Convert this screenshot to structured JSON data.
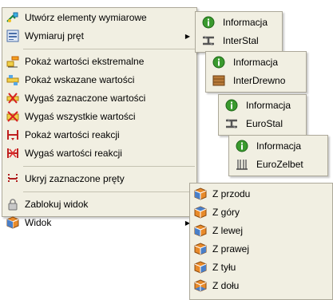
{
  "main_menu": {
    "items": [
      {
        "label": "Utwórz elementy wymiarowe",
        "icon": "create-dimension-elements-icon"
      },
      {
        "label": "Wymiaruj pręt",
        "icon": "dimension-bar-icon",
        "has_submenu": true
      },
      {
        "label": "Pokaż wartości ekstremalne",
        "icon": "show-extreme-values-icon"
      },
      {
        "label": "Pokaż wskazane wartości",
        "icon": "show-selected-values-icon"
      },
      {
        "label": "Wygaś zaznaczone wartości",
        "icon": "hide-selected-values-icon"
      },
      {
        "label": "Wygaś wszystkie wartości",
        "icon": "hide-all-values-icon"
      },
      {
        "label": "Pokaż wartości reakcji",
        "icon": "show-reaction-values-icon"
      },
      {
        "label": "Wygaś wartości reakcji",
        "icon": "hide-reaction-values-icon"
      },
      {
        "label": "Ukryj zaznaczone pręty",
        "icon": "hide-selected-bars-icon"
      },
      {
        "label": "Zablokuj widok",
        "icon": "lock-icon"
      },
      {
        "label": "Widok",
        "icon": "view-cube-icon",
        "has_submenu": true
      }
    ],
    "submenu_arrow": "▶"
  },
  "submenu_interstal": {
    "items": [
      {
        "label": "Informacja"
      },
      {
        "label": "InterStal"
      }
    ]
  },
  "submenu_interdrewno": {
    "items": [
      {
        "label": "Informacja"
      },
      {
        "label": "InterDrewno"
      }
    ]
  },
  "submenu_eurostal": {
    "items": [
      {
        "label": "Informacja"
      },
      {
        "label": "EuroStal"
      }
    ]
  },
  "submenu_eurozelbet": {
    "items": [
      {
        "label": "Informacja"
      },
      {
        "label": "EuroZelbet"
      }
    ]
  },
  "submenu_widok": {
    "items": [
      {
        "label": "Z przodu"
      },
      {
        "label": "Z góry"
      },
      {
        "label": "Z lewej"
      },
      {
        "label": "Z prawej"
      },
      {
        "label": "Z tyłu"
      },
      {
        "label": "Z dołu"
      }
    ]
  },
  "colors": {
    "menu_background": "#f1efe2",
    "menu_border": "#aca899",
    "info_green": "#3a9a2e",
    "view_cube_orange": "#e88a2a",
    "view_cube_blue": "#4a7fc8"
  }
}
